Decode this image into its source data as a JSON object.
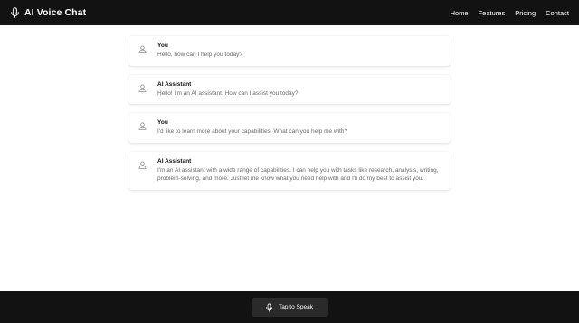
{
  "header": {
    "title": "AI Voice Chat",
    "icon": "microphone-icon",
    "nav": [
      {
        "label": "Home"
      },
      {
        "label": "Features"
      },
      {
        "label": "Pricing"
      },
      {
        "label": "Contact"
      }
    ]
  },
  "messages": [
    {
      "sender": "You",
      "text": "Hello, how can I help you today?",
      "icon": "user-icon"
    },
    {
      "sender": "AI Assistant",
      "text": "Hello! I'm an AI assistant. How can I assist you today?",
      "icon": "user-icon"
    },
    {
      "sender": "You",
      "text": "I'd like to learn more about your capabilities. What can you help me with?",
      "icon": "user-icon"
    },
    {
      "sender": "AI Assistant",
      "text": "I'm an AI assistant with a wide range of capabilities. I can help you with tasks like research, analysis, writing, problem-solving, and more. Just let me know what you need help with and I'll do my best to assist you.",
      "icon": "user-icon"
    }
  ],
  "footer": {
    "speak_label": "Tap to Speak",
    "icon": "microphone-icon"
  },
  "colors": {
    "header_bg": "#121212",
    "footer_bg": "#121212",
    "button_bg": "#2a2a2a",
    "text_muted": "#6b6b6b"
  }
}
